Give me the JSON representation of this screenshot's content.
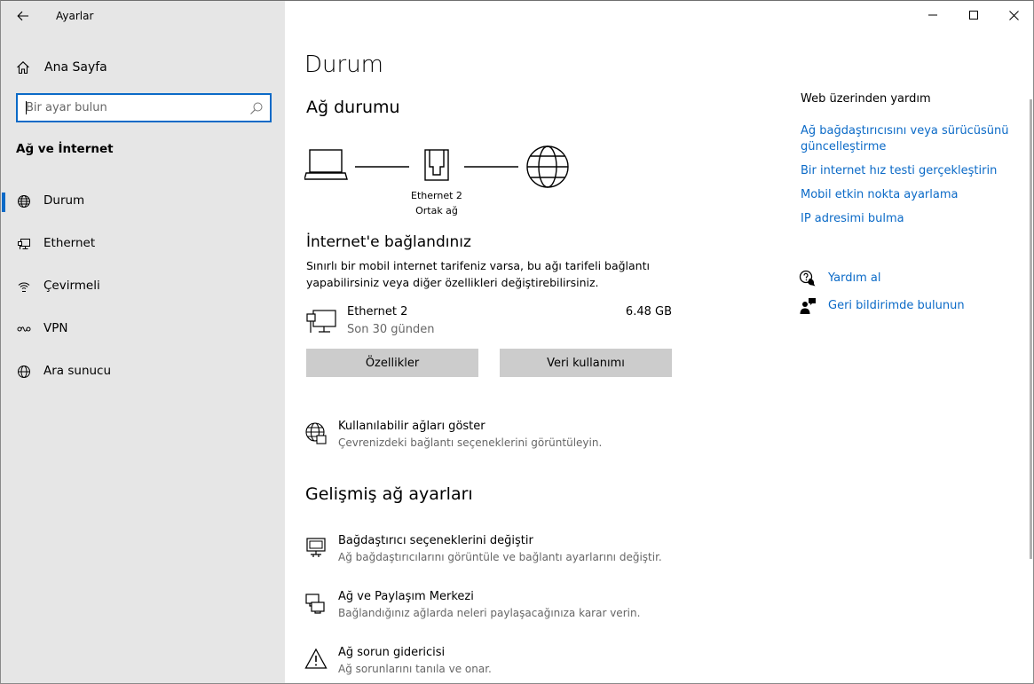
{
  "window": {
    "app_title": "Ayarlar",
    "controls": [
      "minimize",
      "maximize",
      "close"
    ]
  },
  "sidebar": {
    "home_label": "Ana Sayfa",
    "search": {
      "placeholder": "Bir ayar bulun",
      "value": ""
    },
    "section_title": "Ağ ve İnternet",
    "items": [
      {
        "label": "Durum",
        "icon": "globe-status-icon",
        "selected": true
      },
      {
        "label": "Ethernet",
        "icon": "ethernet-icon",
        "selected": false
      },
      {
        "label": "Çevirmeli",
        "icon": "dialup-icon",
        "selected": false
      },
      {
        "label": "VPN",
        "icon": "vpn-icon",
        "selected": false
      },
      {
        "label": "Ara sunucu",
        "icon": "proxy-globe-icon",
        "selected": false
      }
    ]
  },
  "main": {
    "title": "Durum",
    "network_status_title": "Ağ durumu",
    "diagram": {
      "adapter_name": "Ethernet 2",
      "network_type": "Ortak ağ"
    },
    "connected_title": "İnternet'e bağlandınız",
    "connected_desc": "Sınırlı bir mobil internet tarifeniz varsa, bu ağı tarifeli bağlantı yapabilirsiniz veya diğer özellikleri değiştirebilirsiniz.",
    "adapter": {
      "name": "Ethernet 2",
      "period": "Son 30 günden",
      "usage": "6.48 GB"
    },
    "buttons": {
      "properties": "Özellikler",
      "data_usage": "Veri kullanımı"
    },
    "show_networks": {
      "title": "Kullanılabilir ağları göster",
      "sub": "Çevrenizdeki bağlantı seçeneklerini görüntüleyin."
    },
    "advanced_title": "Gelişmiş ağ ayarları",
    "advanced_items": [
      {
        "title": "Bağdaştırıcı seçeneklerini değiştir",
        "sub": "Ağ bağdaştırıcılarını görüntüle ve bağlantı ayarlarını değiştir."
      },
      {
        "title": "Ağ ve Paylaşım Merkezi",
        "sub": "Bağlandığınız ağlarda neleri paylaşacağınıza karar verin."
      },
      {
        "title": "Ağ sorun gidericisi",
        "sub": "Ağ sorunlarını tanıla ve onar."
      }
    ]
  },
  "help": {
    "title": "Web üzerinden yardım",
    "links": [
      "Ağ bağdaştırıcısını veya sürücüsünü güncelleştirme",
      "Bir internet hız testi gerçekleştirin",
      "Mobil etkin nokta ayarlama",
      "IP adresimi bulma"
    ],
    "get_help": "Yardım al",
    "feedback": "Geri bildirimde bulunun"
  },
  "colors": {
    "accent": "#0b6ac7",
    "sidebar_bg": "#e6e6e6",
    "button_bg": "#cccccc"
  }
}
